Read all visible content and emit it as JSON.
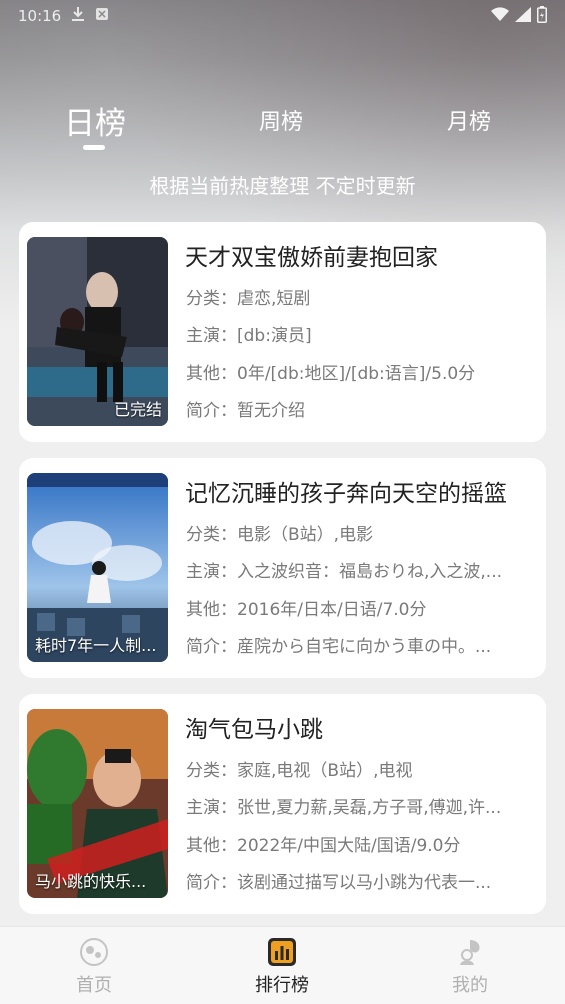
{
  "status_bar": {
    "time": "10:16"
  },
  "tabs": [
    {
      "label": "日榜",
      "active": true
    },
    {
      "label": "周榜",
      "active": false
    },
    {
      "label": "月榜",
      "active": false
    }
  ],
  "subtitle": "根据当前热度整理 不定时更新",
  "cards": [
    {
      "title": "天才双宝傲娇前妻抱回家",
      "poster_caption": "已完结",
      "category": "分类：虐恋,短剧",
      "cast": "主演：[db:演员]",
      "other": "其他：0年/[db:地区]/[db:语言]/5.0分",
      "intro": "简介：暂无介绍"
    },
    {
      "title": "记忆沉睡的孩子奔向天空的摇篮",
      "poster_caption": "耗时7年一人制...",
      "category": "分类：电影（B站）,电影",
      "cast": "主演：入之波织音：福島おりね,入之波,...",
      "other": "其他：2016年/日本/日语/7.0分",
      "intro": "简介：産院から自宅に向かう車の中。..."
    },
    {
      "title": "淘气包马小跳",
      "poster_caption": "马小跳的快乐...",
      "category": "分类：家庭,电视（B站）,电视",
      "cast": "主演：张世,夏力薪,吴磊,方子哥,傅迦,许...",
      "other": "其他：2022年/中国大陆/国语/9.0分",
      "intro": "简介：该剧通过描写以马小跳为代表一..."
    }
  ],
  "bottom_nav": [
    {
      "label": "首页",
      "icon": "home-icon",
      "active": false
    },
    {
      "label": "排行榜",
      "icon": "ranking-icon",
      "active": true
    },
    {
      "label": "我的",
      "icon": "profile-icon",
      "active": false
    }
  ],
  "colors": {
    "active_nav": "#222222",
    "inactive_nav": "#b0b0b0",
    "rank_icon_bg": "#f0a020"
  }
}
